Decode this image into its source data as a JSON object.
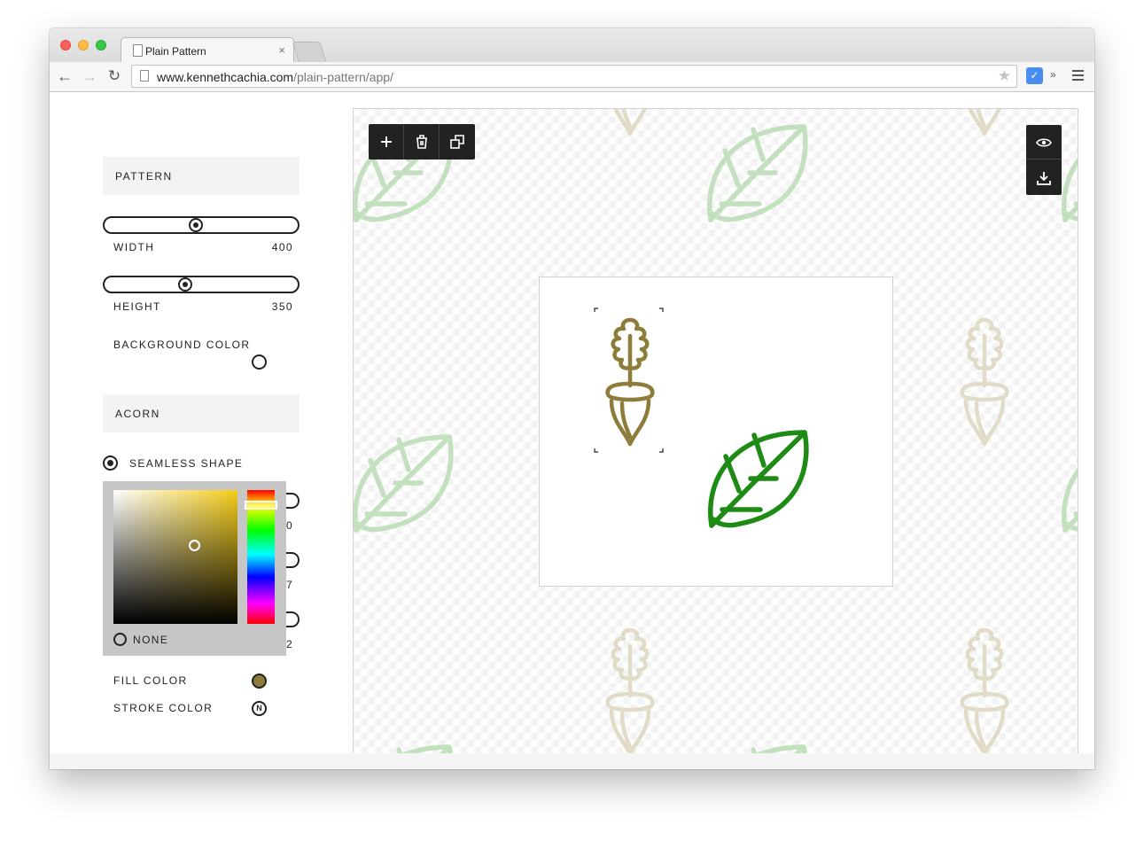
{
  "browser": {
    "tab_title": "Plain Pattern",
    "tab_close": "×",
    "url_host": "www.kennethcachia.com",
    "url_path": "/plain-pattern/app/",
    "back": "←",
    "forward": "→",
    "reload": "↻",
    "star": "★",
    "extension": "✓",
    "overflow": "»"
  },
  "sidebar": {
    "pattern_header": "PATTERN",
    "width_label": "WIDTH",
    "width_value": "400",
    "width_slider_fraction": 0.47,
    "height_label": "HEIGHT",
    "height_value": "350",
    "height_slider_fraction": 0.41,
    "background_color_label": "BACKGROUND COLOR",
    "acorn_header": "ACORN",
    "seamless_shape_label": "SEAMLESS SHAPE",
    "hidden_values": [
      "0",
      "7",
      "2"
    ],
    "picker": {
      "none_label": "NONE",
      "selected_hue": "#f5cd1a",
      "selected_color": "#8e7d3a"
    },
    "fill_color_label": "FILL COLOR",
    "fill_color": "#8e7d3a",
    "stroke_color_label": "STROKE COLOR",
    "stroke_color_value": "N"
  },
  "canvas": {
    "acorn_color": "#8e7d3a",
    "leaf_color": "#1e8c14",
    "tile_width": 400,
    "tile_height": 350
  },
  "tools": {
    "add_icon": "plus-icon",
    "delete_icon": "trash-icon",
    "duplicate_icon": "duplicate-icon",
    "preview_icon": "eye-icon",
    "download_icon": "download-icon"
  }
}
